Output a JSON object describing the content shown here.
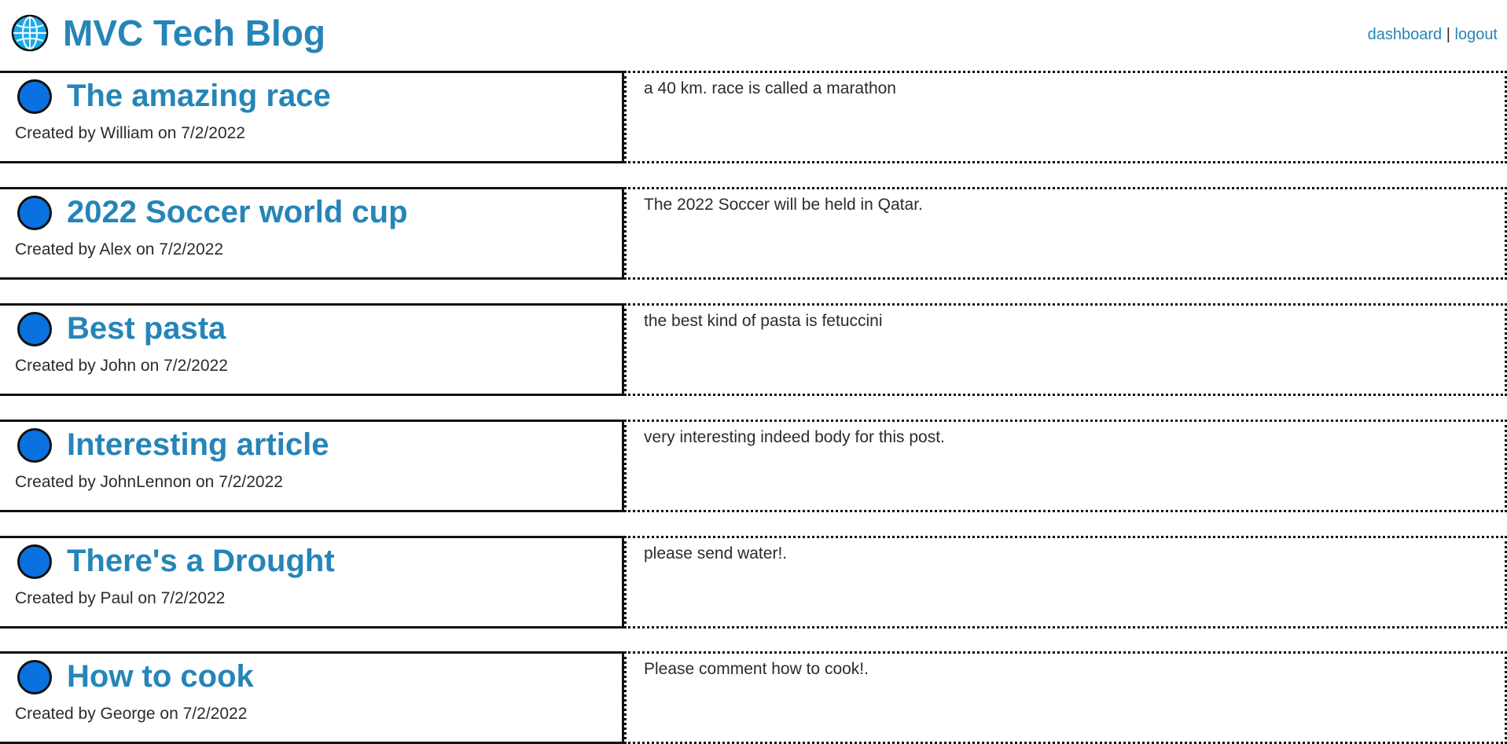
{
  "header": {
    "logo_icon": "globe-icon",
    "title": "MVC Tech Blog",
    "nav": {
      "dashboard_label": "dashboard",
      "separator": "|",
      "logout_label": "logout"
    }
  },
  "colors": {
    "link": "#2585b8",
    "dot": "#0a72e0",
    "border": "#111111"
  },
  "posts": [
    {
      "title": "The amazing race",
      "meta": "Created by William on 7/2/2022",
      "body": "a 40 km. race is called a marathon"
    },
    {
      "title": "2022 Soccer world cup",
      "meta": "Created by Alex on 7/2/2022",
      "body": "The 2022 Soccer will be held in Qatar."
    },
    {
      "title": "Best pasta",
      "meta": "Created by John on 7/2/2022",
      "body": "the best kind of pasta is fetuccini"
    },
    {
      "title": "Interesting article",
      "meta": "Created by JohnLennon on 7/2/2022",
      "body": "very interesting indeed body for this post."
    },
    {
      "title": "There's a Drought",
      "meta": "Created by Paul on 7/2/2022",
      "body": "please send water!."
    },
    {
      "title": "How to cook",
      "meta": "Created by George on 7/2/2022",
      "body": "Please comment how to cook!."
    }
  ]
}
